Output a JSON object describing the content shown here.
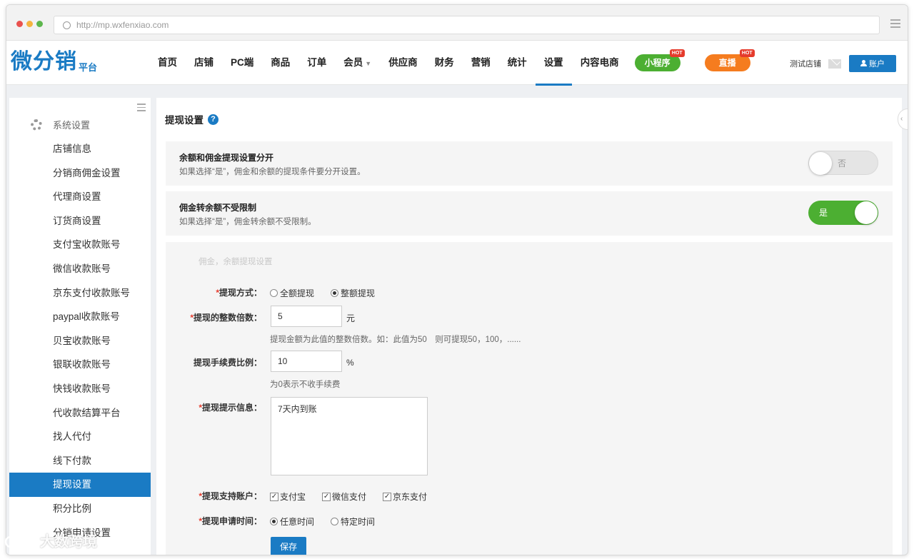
{
  "browser": {
    "url": "http://mp.wxfenxiao.com"
  },
  "logo": {
    "main": "微分销",
    "sub": "平台"
  },
  "nav": {
    "items": [
      "首页",
      "店铺",
      "PC端",
      "商品",
      "订单",
      "会员",
      "供应商",
      "财务",
      "营销",
      "统计",
      "设置",
      "内容电商"
    ],
    "active": "设置",
    "pills": [
      {
        "label": "小程序",
        "badge": "HOT"
      },
      {
        "label": "直播",
        "badge": "HOT"
      }
    ],
    "shop_name": "测试店铺",
    "account_label": "账户"
  },
  "sidebar": {
    "header": "系统设置",
    "items": [
      "店铺信息",
      "分销商佣金设置",
      "代理商设置",
      "订货商设置",
      "支付宝收款账号",
      "微信收款账号",
      "京东支付收款账号",
      "paypal收款账号",
      "贝宝收款账号",
      "银联收款账号",
      "快钱收款账号",
      "代收款结算平台",
      "找人代付",
      "线下付款",
      "提现设置",
      "积分比例",
      "分销申请设置"
    ],
    "active": "提现设置"
  },
  "main": {
    "title": "提现设置",
    "setting1": {
      "title": "余额和佣金提现设置分开",
      "desc": "如果选择“是”，佣金和余额的提现条件要分开设置。",
      "toggle": "否",
      "on": false
    },
    "setting2": {
      "title": "佣金转余额不受限制",
      "desc": "如果选择“是”，佣金转余额不受限制。",
      "toggle": "是",
      "on": true
    },
    "panel_legend": "佣金，余额提现设置",
    "method": {
      "label": "提现方式：",
      "options": [
        "全额提现",
        "整额提现"
      ],
      "selected": "整额提现"
    },
    "multiple": {
      "label": "提现的整数倍数：",
      "value": "5",
      "unit": "元",
      "hint": "提现金额为此值的整数倍数。如：此值为50　则可提现50，100，......"
    },
    "fee": {
      "label": "提现手续费比例：",
      "value": "10",
      "unit": "%",
      "hint": "为0表示不收手续费"
    },
    "message": {
      "label": "提现提示信息：",
      "value": "7天内到账"
    },
    "accounts": {
      "label": "提现支持账户：",
      "options": [
        "支付宝",
        "微信支付",
        "京东支付"
      ],
      "checked": [
        true,
        true,
        true
      ]
    },
    "time": {
      "label": "提现申请时间：",
      "options": [
        "任意时间",
        "特定时间"
      ],
      "selected": "任意时间"
    },
    "save_label": "保存"
  },
  "watermark": "大数跨境"
}
